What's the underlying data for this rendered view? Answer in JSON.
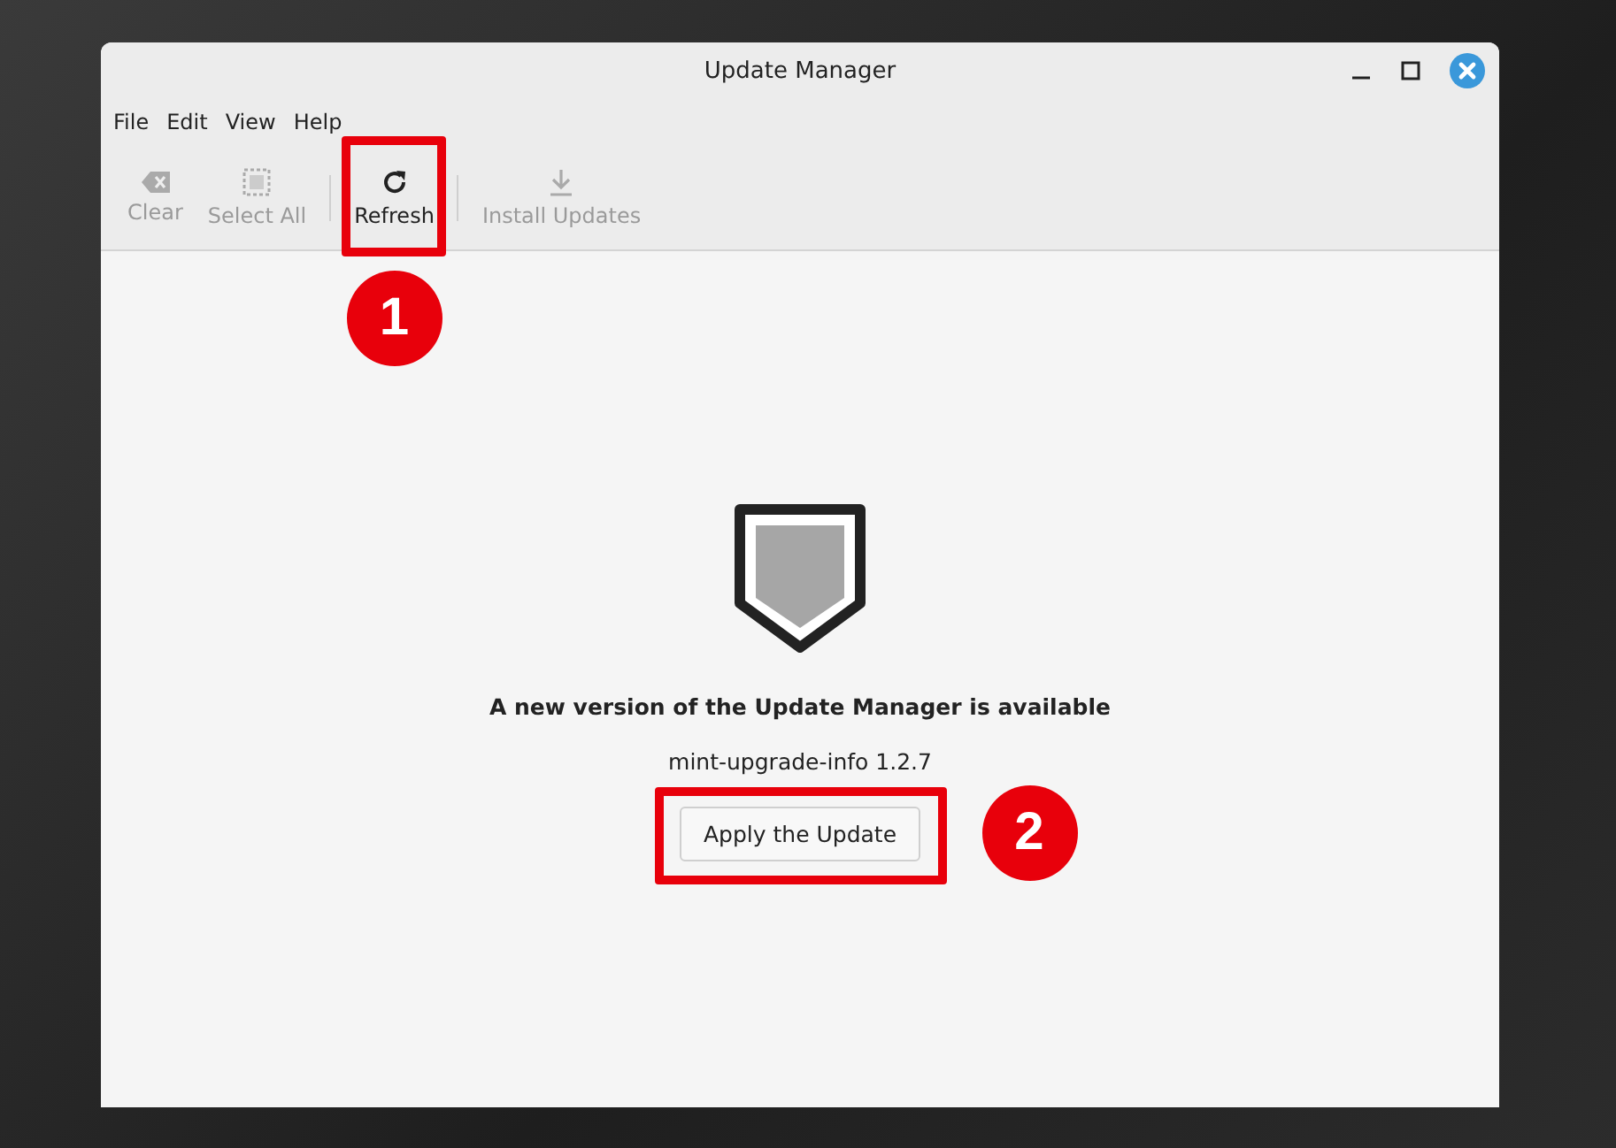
{
  "window": {
    "title": "Update Manager"
  },
  "menu": [
    "File",
    "Edit",
    "View",
    "Help"
  ],
  "toolbar": [
    {
      "kind": "clear",
      "label": "Clear",
      "disabled": true
    },
    {
      "kind": "select-all",
      "label": "Select All",
      "disabled": true
    },
    {
      "kind": "refresh",
      "label": "Refresh",
      "disabled": false,
      "step": "1"
    },
    {
      "kind": "install",
      "label": "Install Updates",
      "disabled": true
    }
  ],
  "notice": {
    "heading": "A new version of the Update Manager is available",
    "version": "mint-upgrade-info 1.2.7",
    "button": "Apply the Update",
    "step": "2"
  }
}
